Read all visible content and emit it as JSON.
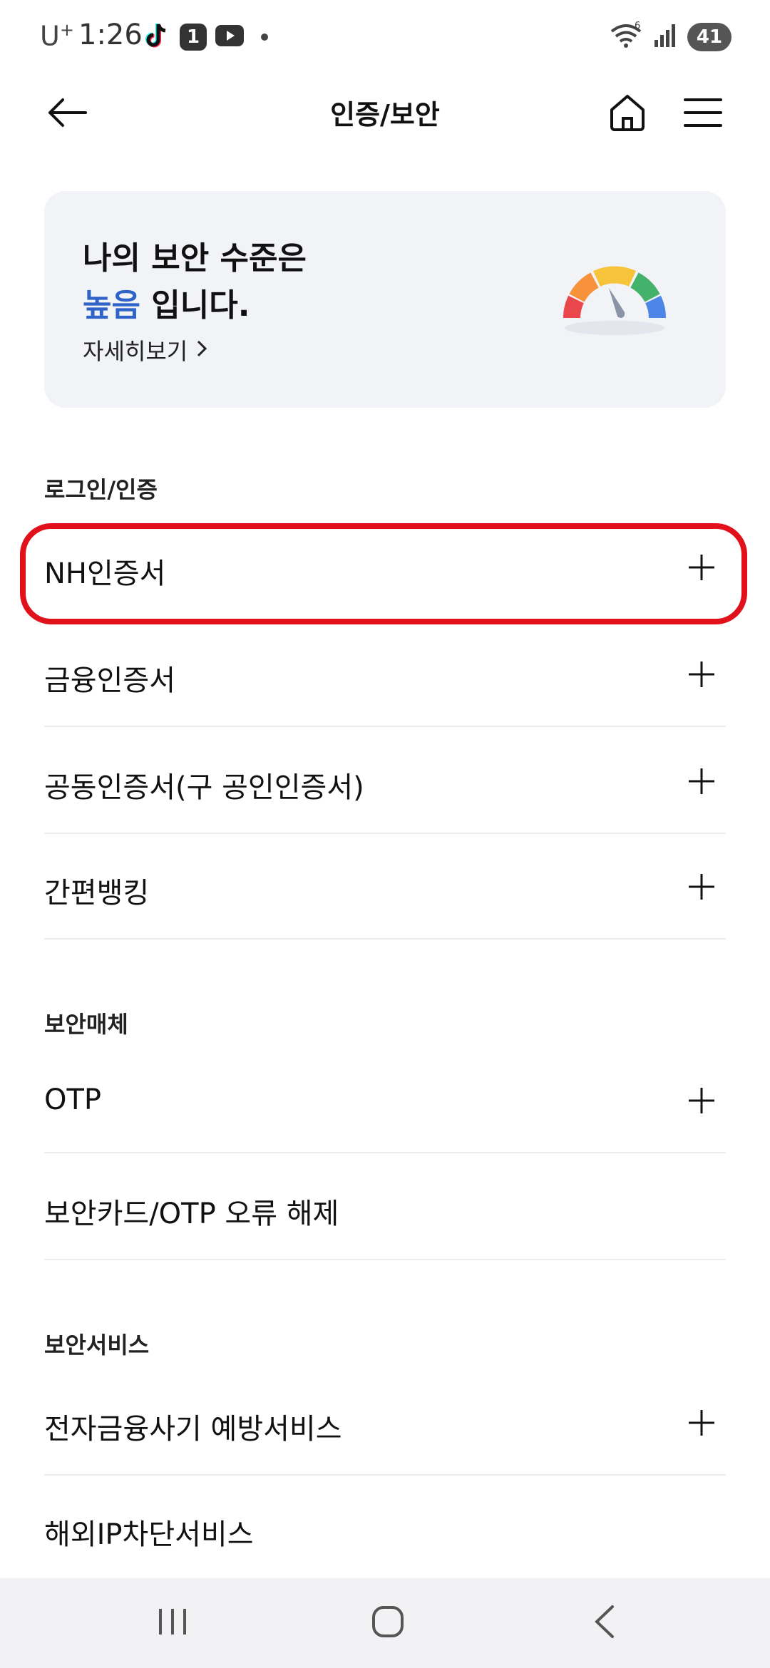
{
  "status_bar": {
    "carrier": "U",
    "carrier_sup": "+",
    "time": "1:26",
    "notif_badge": "1",
    "signal_label": "6",
    "battery": "41",
    "icons": [
      "tiktok-icon",
      "notification-count-icon",
      "youtube-icon",
      "dot-icon",
      "wifi-icon",
      "signal-icon",
      "battery-icon"
    ]
  },
  "header": {
    "title": "인증/보안",
    "icons": [
      "back-arrow-icon",
      "home-icon",
      "menu-icon"
    ]
  },
  "security_card": {
    "line1": "나의 보안 수준은",
    "level": "높음",
    "line2_suffix": " 입니다.",
    "detail_link": "자세히보기",
    "gauge_icon": "security-gauge-icon",
    "gauge_colors": [
      "#e9474b",
      "#f7913c",
      "#f7c33a",
      "#44b26a",
      "#4d86e6"
    ]
  },
  "sections": [
    {
      "title": "로그인/인증",
      "items": [
        {
          "label": "NH인증서",
          "expandable": true
        },
        {
          "label": "금융인증서",
          "expandable": true
        },
        {
          "label": "공동인증서(구 공인인증서)",
          "expandable": true
        },
        {
          "label": "간편뱅킹",
          "expandable": true
        }
      ]
    },
    {
      "title": "보안매체",
      "items": [
        {
          "label": "OTP",
          "expandable": true
        },
        {
          "label": "보안카드/OTP 오류 해제",
          "expandable": false
        }
      ]
    },
    {
      "title": "보안서비스",
      "items": [
        {
          "label": "전자금융사기 예방서비스",
          "expandable": true
        },
        {
          "label": "해외IP차단서비스",
          "expandable": false
        }
      ]
    }
  ],
  "highlight_color": "#e0111b",
  "accent_color": "#2f63c7",
  "nav_bar": {
    "icons": [
      "recent-apps-icon",
      "home-button-icon",
      "back-icon"
    ]
  }
}
